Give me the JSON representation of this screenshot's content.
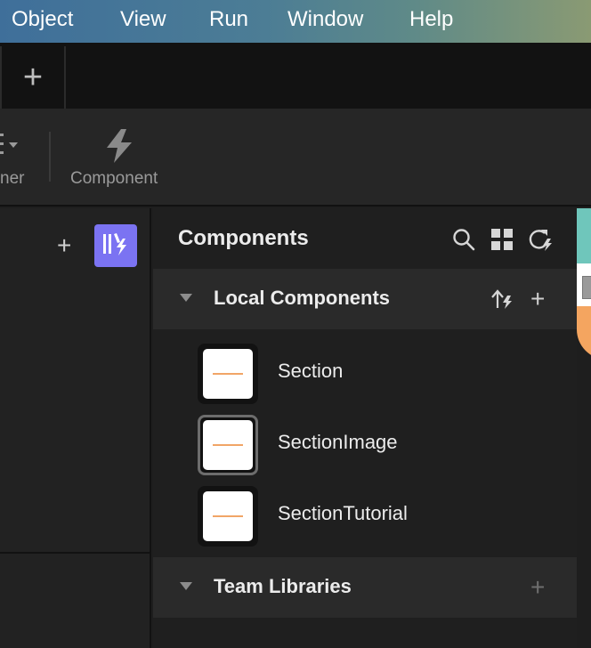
{
  "menubar": {
    "items": [
      "Object",
      "View",
      "Run",
      "Window",
      "Help"
    ]
  },
  "tabbar": {
    "add_label": "+"
  },
  "toolbar": {
    "partial_label": "ner",
    "component_label": "Component"
  },
  "left_panel": {
    "add_label": "+",
    "library_icon": "library-bolt-icon",
    "accent": "#7b73f2"
  },
  "components_panel": {
    "title": "Components",
    "icons": [
      "search-icon",
      "grid-icon",
      "refresh-icon"
    ],
    "local": {
      "title": "Local Components",
      "add_label": "+",
      "items": [
        {
          "name": "Section",
          "selected": false
        },
        {
          "name": "SectionImage",
          "selected": true
        },
        {
          "name": "SectionTutorial",
          "selected": false
        }
      ]
    },
    "team": {
      "title": "Team Libraries",
      "add_label": "+"
    }
  },
  "colors": {
    "thumb_line": "#f1a567",
    "canvas_teal": "#6fc6bb",
    "canvas_orange": "#f4a560"
  }
}
